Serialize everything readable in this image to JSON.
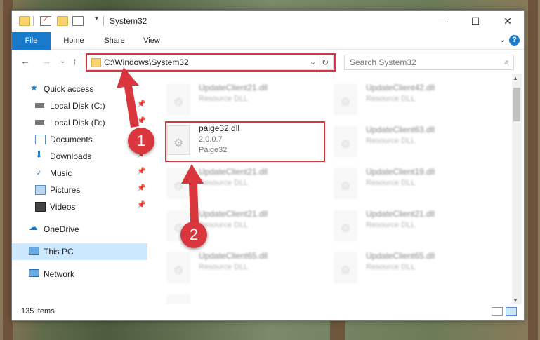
{
  "window": {
    "title": "System32"
  },
  "titlebar_buttons": {
    "minimize": "—",
    "maximize": "☐",
    "close": "✕"
  },
  "ribbon": {
    "tabs": [
      "File",
      "Home",
      "Share",
      "View"
    ],
    "help": "?",
    "expand": "⌄"
  },
  "navigation": {
    "back": "←",
    "forward": "→",
    "recent": "⌄",
    "up": "↑"
  },
  "address": {
    "path": "C:\\Windows\\System32",
    "dropdown": "⌄",
    "refresh": "↻"
  },
  "search": {
    "placeholder": "Search System32",
    "icon": "⌕"
  },
  "sidebar": {
    "items": [
      {
        "label": "Quick access",
        "icon": "star-icon",
        "pin": ""
      },
      {
        "label": "Local Disk (C:)",
        "icon": "drive-icon",
        "pin": "📌"
      },
      {
        "label": "Local Disk (D:)",
        "icon": "drive-icon",
        "pin": "📌"
      },
      {
        "label": "Documents",
        "icon": "documents-icon",
        "pin": "📌"
      },
      {
        "label": "Downloads",
        "icon": "downloads-icon",
        "pin": "📌"
      },
      {
        "label": "Music",
        "icon": "music-icon",
        "pin": "📌"
      },
      {
        "label": "Pictures",
        "icon": "pictures-icon",
        "pin": "📌"
      },
      {
        "label": "Videos",
        "icon": "videos-icon",
        "pin": "📌"
      },
      {
        "label": "OneDrive",
        "icon": "cloud-icon",
        "pin": ""
      },
      {
        "label": "This PC",
        "icon": "computer-icon",
        "pin": ""
      },
      {
        "label": "Network",
        "icon": "network-icon",
        "pin": ""
      }
    ]
  },
  "files": {
    "blurred": [
      {
        "name": "UpdateClient21.dll",
        "type": "Resource DLL"
      },
      {
        "name": "UpdateClient42.dll",
        "type": "Resource DLL"
      },
      {
        "name": "UpdateClient63.dll",
        "type": "Resource DLL"
      },
      {
        "name": "UpdateClient21.dll",
        "type": "Resource DLL"
      },
      {
        "name": "UpdateClient19.dll",
        "type": "Resource DLL"
      },
      {
        "name": "UpdateClient21.dll",
        "type": "Resource DLL"
      },
      {
        "name": "UpdateClient21.dll",
        "type": "Resource DLL"
      },
      {
        "name": "UpdateClient65.dll",
        "type": "Resource DLL"
      },
      {
        "name": "UpdateClient65.dll",
        "type": "Resource DLL"
      }
    ],
    "highlighted": {
      "name": "paige32.dll",
      "version": "2.0.0.7",
      "description": "Paige32"
    }
  },
  "status": {
    "item_count": "135 items"
  },
  "markers": {
    "step1": "1",
    "step2": "2"
  },
  "colors": {
    "accent": "#1979ca",
    "highlight": "#d9363e",
    "selected": "#cce8ff"
  }
}
